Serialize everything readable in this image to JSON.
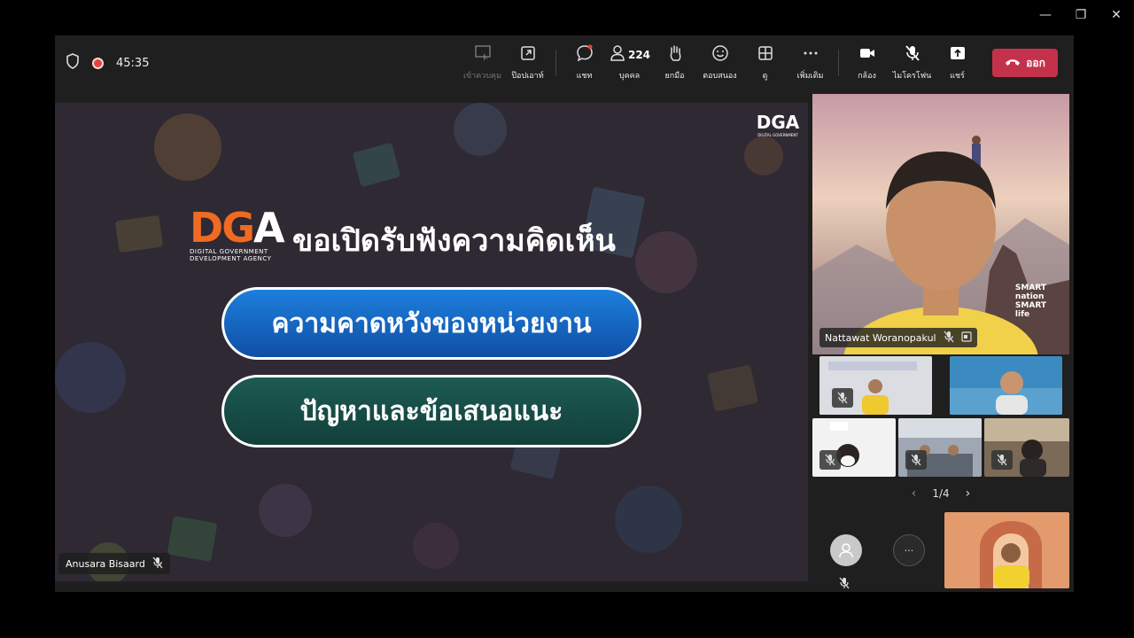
{
  "window": {
    "minimize": "—",
    "maximize": "❐",
    "close": "✕"
  },
  "meeting": {
    "timer": "45:35"
  },
  "toolbar": {
    "join": "เข้าควบคุม",
    "popout": "ป๊อปเอาท์",
    "chat": "แชท",
    "people_count": "224",
    "people": "บุคคล",
    "raise": "ยกมือ",
    "react": "ตอบสนอง",
    "view": "ดู",
    "more": "เพิ่มเติม",
    "camera": "กล้อง",
    "mic": "ไมโครโฟน",
    "share": "แชร์",
    "leave": "ออก"
  },
  "slide": {
    "corner_logo": "DGA",
    "logo_sub_1": "DIGITAL GOVERNMENT",
    "logo_sub_2": "DEVELOPMENT AGENCY",
    "title": "ขอเปิดรับฟังความคิดเห็น",
    "pill_1": "ความคาดหวังของหน่วยงาน",
    "pill_2": "ปัญหาและข้อเสนอแนะ",
    "presenter": "Anusara Bisaard"
  },
  "panel": {
    "main_name": "Nattawat Woranopakul",
    "smart_text_1": "SMART",
    "smart_text_2": "nation",
    "smart_text_3": "SMART",
    "smart_text_4": "life",
    "page": "1/4",
    "more_label": "···"
  }
}
